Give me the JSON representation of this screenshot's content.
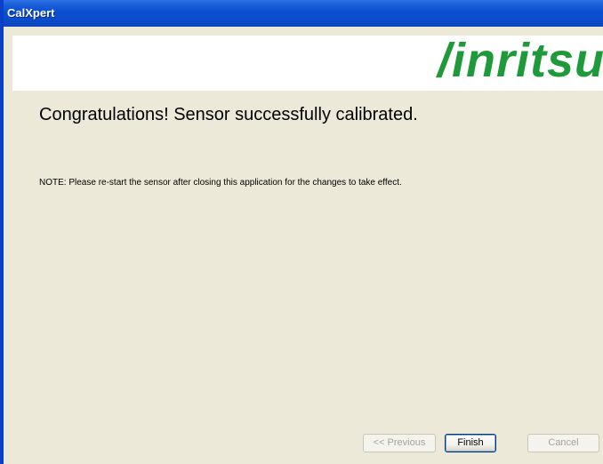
{
  "window": {
    "title": "CalXpert"
  },
  "header": {
    "logo_text": "/inritsu"
  },
  "main": {
    "heading": "Congratulations! Sensor successfully calibrated.",
    "note": "NOTE: Please re-start the sensor after closing this application for the changes to take effect."
  },
  "buttons": {
    "previous_label": "<< Previous",
    "finish_label": "Finish",
    "cancel_label": "Cancel"
  },
  "colors": {
    "titlebar": "#0a4fd0",
    "brand_green": "#1f9a3a",
    "dialog_background": "#ece9d8"
  }
}
